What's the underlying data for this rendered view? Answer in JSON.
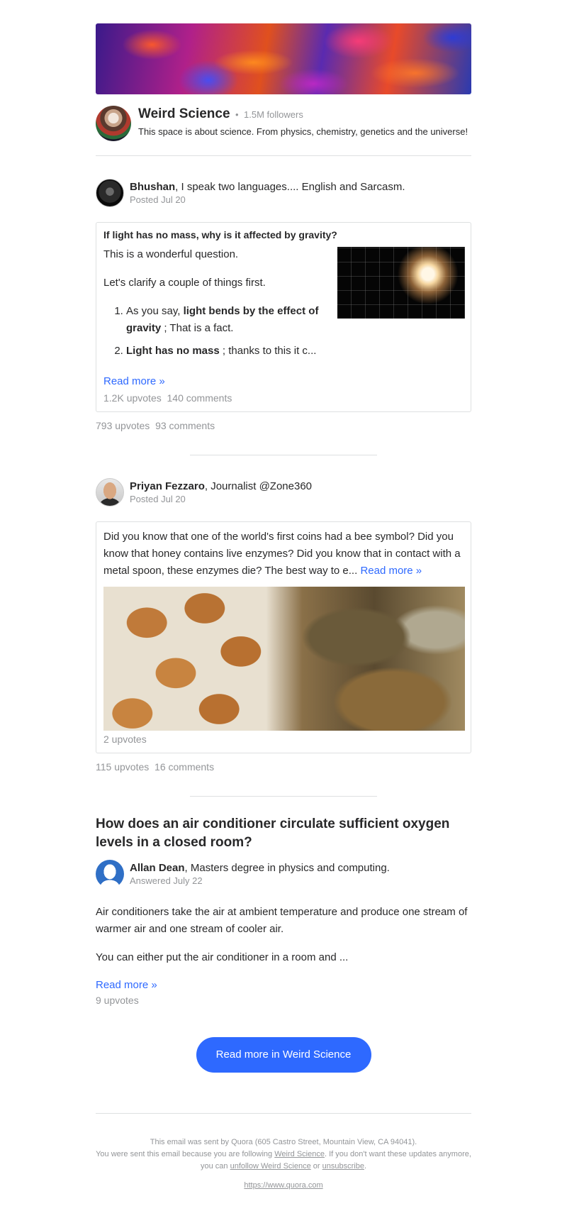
{
  "space": {
    "name": "Weird Science",
    "followers": "1.5M followers",
    "separator": "•",
    "description": "This space is about science. From physics, chemistry, genetics and the universe!"
  },
  "post1": {
    "author": "Bhushan",
    "credential": ", I speak two languages.... English and Sarcasm.",
    "posted": "Posted Jul 20",
    "question": "If light has no mass, why is it affected by gravity?",
    "para1": "This is a wonderful question.",
    "para2": "Let's clarify a couple of things first.",
    "li1_pre": "As you say, ",
    "li1_bold": "light bends by the effect of gravity",
    "li1_post": " ; That is a fact.",
    "li2_bold": "Light has no mass",
    "li2_post": " ; thanks to this it c...",
    "read_more": "Read more »",
    "card_upvotes": "1.2K upvotes",
    "card_comments": "140 comments",
    "upvotes": "793 upvotes",
    "comments": "93 comments"
  },
  "post2": {
    "author": "Priyan Fezzaro",
    "credential": ", Journalist @Zone360",
    "posted": "Posted Jul 20",
    "text": "Did you know that one of the world's first coins had a bee symbol? Did you know that honey contains live enzymes? Did you know that in contact with a metal spoon, these enzymes die? The best way to e...",
    "read_more": "Read more »",
    "card_upvotes": "2 upvotes",
    "upvotes": "115 upvotes",
    "comments": "16 comments"
  },
  "post3": {
    "question": "How does an air conditioner circulate sufficient oxygen levels in a closed room?",
    "author": "Allan Dean",
    "credential": ", Masters degree in physics and computing.",
    "answered": "Answered July 22",
    "para1": "Air conditioners take the air at ambient temperature and produce one stream of warmer air and one stream of cooler air.",
    "para2": "You can either put the air conditioner in a room and ...",
    "read_more": "Read more »",
    "upvotes": "9 upvotes"
  },
  "cta": {
    "label": "Read more in Weird Science"
  },
  "footer": {
    "line1": "This email was sent by Quora (605 Castro Street, Mountain View, CA 94041).",
    "line2_pre": "You were sent this email because you are following ",
    "line2_link": "Weird Science",
    "line2_mid": ". If you don't want these updates anymore, you can ",
    "unfollow_link": "unfollow Weird Science",
    "or": " or ",
    "unsubscribe_link": "unsubscribe",
    "end": ".",
    "url": "https://www.quora.com"
  },
  "colors": {
    "accent": "#2e69ff",
    "muted": "#939598",
    "text": "#282829",
    "border": "#dee0e1"
  }
}
